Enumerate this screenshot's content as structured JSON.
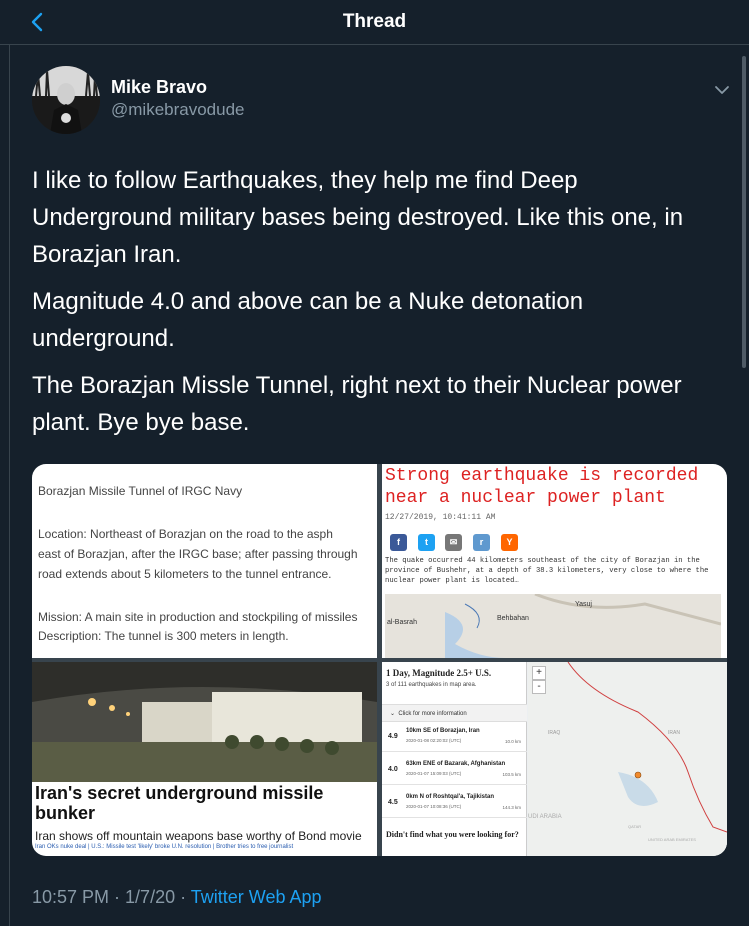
{
  "header": {
    "title": "Thread"
  },
  "user": {
    "name": "Mike Bravo",
    "handle": "@mikebravodude"
  },
  "tweet": {
    "paragraphs": [
      "I like to follow Earthquakes, they help me find Deep Underground military bases being destroyed. Like this one, in Borazjan Iran.",
      "Magnitude 4.0 and above can be a Nuke detonation underground.",
      "The Borazjan Missle Tunnel, right next to their Nuclear power plant. Bye bye base."
    ]
  },
  "media": {
    "image1": {
      "title": "Borazjan Missile Tunnel of IRGC Navy",
      "lines": [
        "Location: Northeast of Borazjan on the road to the asph",
        " east of Borazjan, after the IRGC base; after passing through",
        "road extends about 5 kilometers to the tunnel entrance.",
        "Mission: A main site in production and stockpiling of missiles",
        "Description: The tunnel is 300 meters in length."
      ]
    },
    "image2": {
      "headline": "Strong earthquake is recorded near a nuclear power plant",
      "date": "12/27/2019, 10:41:11 AM",
      "share_icons": [
        "f",
        "t",
        "✉",
        "r",
        "Y"
      ],
      "body": "The quake occurred 44 kilometers southeast of the city of Borazjan in the province of Bushehr, at a depth of 38.3 kilometers, very close to where the nuclear power plant is located…",
      "map_labels": [
        "al-Basrah",
        "Behbahan",
        "Yasuj"
      ]
    },
    "image3": {
      "headline": "Iran's secret underground missile bunker",
      "subhead": "Iran shows off mountain weapons base worthy of Bond movie",
      "links": "Iran OKs nuke deal | U.S.: Missile test 'likely' broke U.N. resolution | Brother tries to free journalist"
    },
    "image4": {
      "title": "1 Day, Magnitude 2.5+ U.S.",
      "count": "3 of 111 earthquakes in map area.",
      "more": "Click for more information",
      "quakes": [
        {
          "mag": "4.9",
          "loc": "10km SE of Borazjan, Iran",
          "time": "2020-01-08 02:20:02 (UTC)",
          "depth": "10.0 km"
        },
        {
          "mag": "4.0",
          "loc": "63km ENE of Bazarak, Afghanistan",
          "time": "2020-01-07 15:09:03 (UTC)",
          "depth": "103.5 km"
        },
        {
          "mag": "4.5",
          "loc": "0km N of Roshtqal'a, Tajikistan",
          "time": "2020-01-07 10:08:36 (UTC)",
          "depth": "144.3 km"
        }
      ],
      "footer": "Didn't find what you were looking for?",
      "map_labels": [
        "IRAQ",
        "IRAN",
        "UDI ARABIA",
        "QATAR",
        "UNITED ARAB EMIRATES"
      ],
      "zoom_in": "+",
      "zoom_out": "-"
    }
  },
  "meta": {
    "timestamp": "10:57 PM · 1/7/20 · ",
    "source": "Twitter Web App"
  },
  "colors": {
    "background": "#15202b",
    "accent": "#1da1f2",
    "muted": "#8899a6",
    "border": "#38444d"
  }
}
